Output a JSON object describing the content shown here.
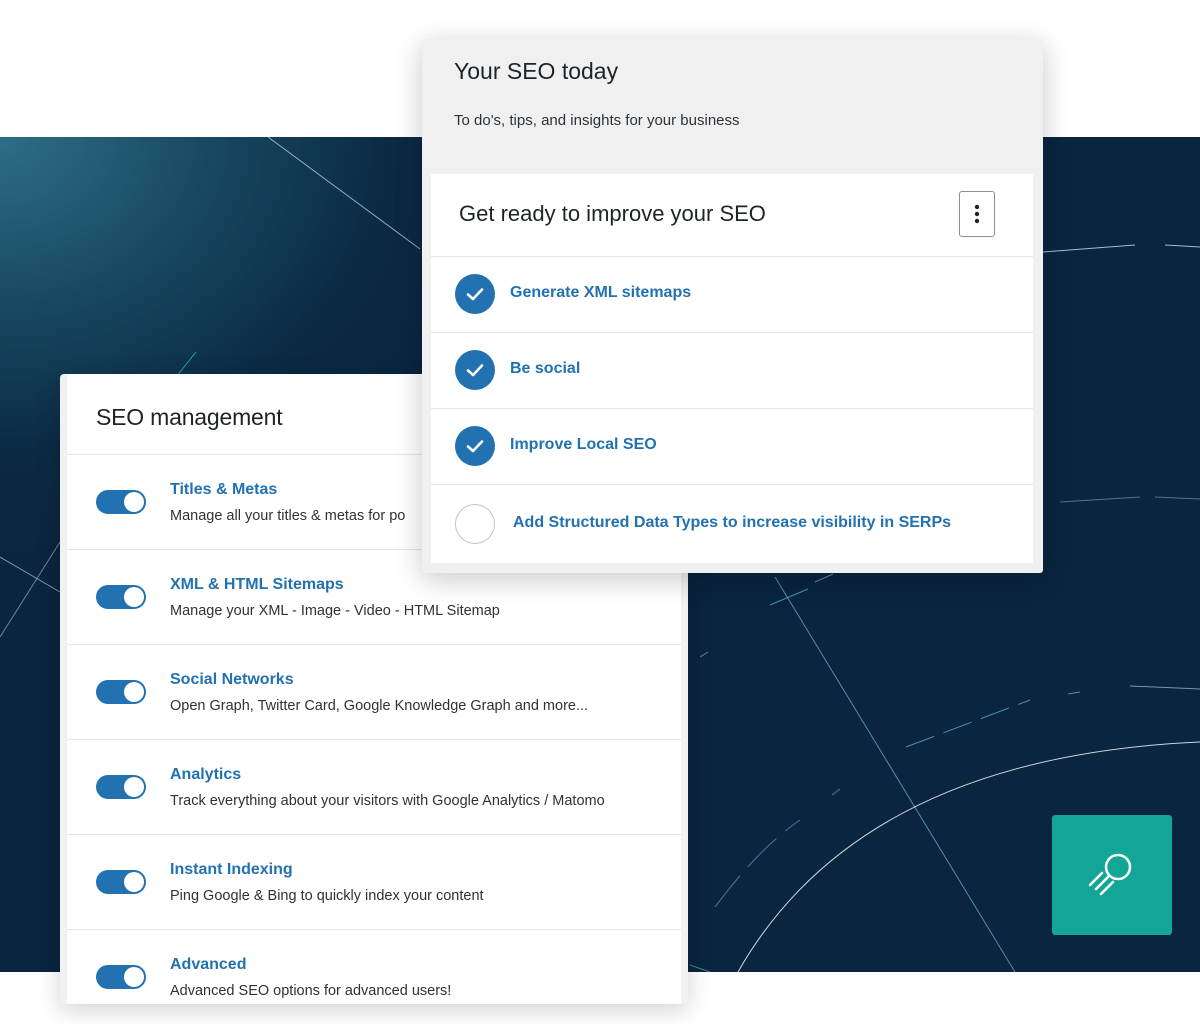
{
  "management": {
    "title": "SEO management",
    "items": [
      {
        "title": "Titles & Metas",
        "desc": "Manage all your titles & metas for po",
        "enabled": true
      },
      {
        "title": "XML & HTML Sitemaps",
        "desc": "Manage your XML - Image - Video - HTML Sitemap",
        "enabled": true
      },
      {
        "title": "Social Networks",
        "desc": "Open Graph, Twitter Card, Google Knowledge Graph and more...",
        "enabled": true
      },
      {
        "title": "Analytics",
        "desc": "Track everything about your visitors with Google Analytics / Matomo",
        "enabled": true
      },
      {
        "title": "Instant Indexing",
        "desc": "Ping Google & Bing to quickly index your content",
        "enabled": true
      },
      {
        "title": "Advanced",
        "desc": "Advanced SEO options for advanced users!",
        "enabled": true
      }
    ]
  },
  "today": {
    "title": "Your SEO today",
    "subtitle": "To do's, tips, and insights for your business",
    "tasks_title": "Get ready to improve your SEO",
    "menu_icon": "kebab-menu-icon",
    "tasks": [
      {
        "label": "Generate XML sitemaps",
        "done": true
      },
      {
        "label": "Be social",
        "done": true
      },
      {
        "label": "Improve Local SEO",
        "done": true
      },
      {
        "label": "Add Structured Data Types to increase visibility in SERPs",
        "done": false
      }
    ]
  },
  "colors": {
    "accent": "#2271b1",
    "brand_tile": "#13a596",
    "hero_dark": "#0a2540"
  },
  "logo_icon": "rocket-search-icon"
}
